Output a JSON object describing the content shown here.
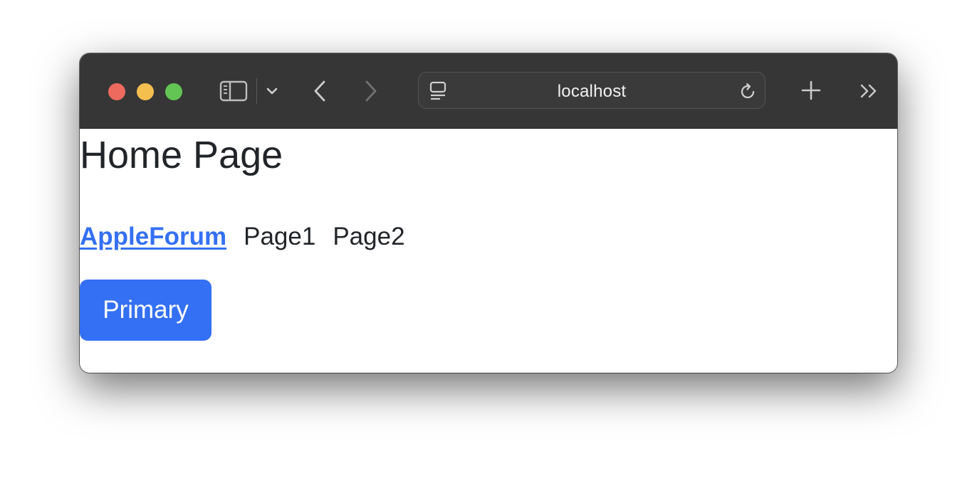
{
  "browser": {
    "address": "localhost"
  },
  "page": {
    "title": "Home Page",
    "nav": {
      "brand": "AppleForum",
      "links": [
        "Page1",
        "Page2"
      ]
    },
    "primary_button": "Primary"
  },
  "colors": {
    "close": "#ee6a5e",
    "minimize": "#f5bf4f",
    "zoom": "#62c554",
    "toolbar": "#363636",
    "link": "#3470f3",
    "button": "#3470f3"
  },
  "icons": [
    "sidebar-icon",
    "chevron-down-icon",
    "back-icon",
    "forward-icon",
    "page-menu-icon",
    "reload-icon",
    "new-tab-icon",
    "more-tabs-icon"
  ]
}
